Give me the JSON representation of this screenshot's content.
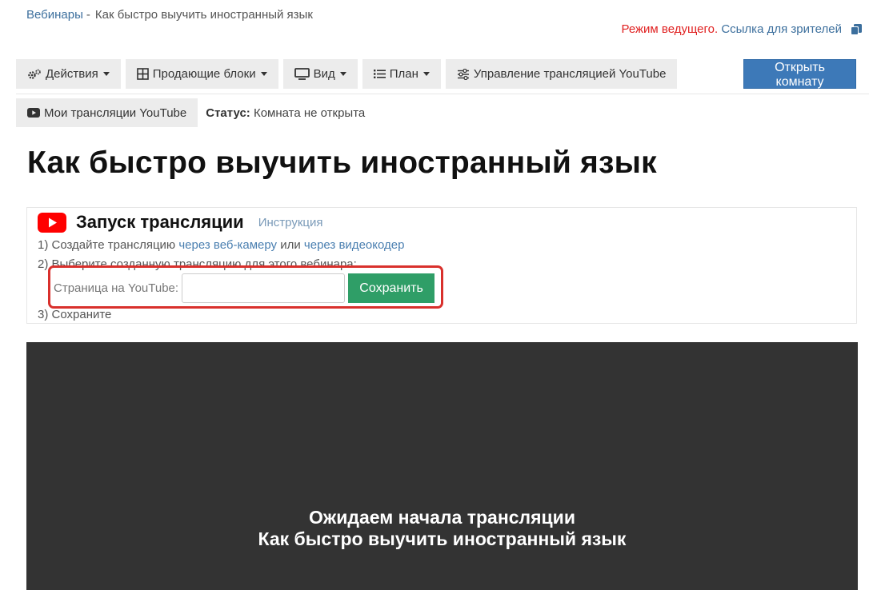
{
  "breadcrumb": {
    "parent": "Вебинары",
    "separator": "-",
    "current": "Как быстро выучить иностранный язык"
  },
  "header": {
    "host_mode": "Режим ведущего.",
    "viewer_link": "Ссылка для зрителей",
    "copy_icon": "copy-icon"
  },
  "toolbar": {
    "actions": "Действия",
    "sales_blocks": "Продающие блоки",
    "view": "Вид",
    "plan": "План",
    "youtube_control": "Управление трансляцией YouTube",
    "open_room": "Открыть комнату"
  },
  "row2": {
    "my_streams": "Мои трансляции YouTube",
    "status_label": "Статус:",
    "status_value": "Комната не открыта"
  },
  "page_title": "Как быстро выучить иностранный язык",
  "panel": {
    "title": "Запуск трансляции",
    "help": "Инструкция",
    "step1_prefix": "1) Создайте трансляцию",
    "step1_link1": "через веб-камеру",
    "step1_mid": "или",
    "step1_link2": "через видеокодер",
    "step2": "2) Выберите созданную трансляцию для этого вебинара:",
    "input_label": "Страница на YouTube:",
    "input_value": "",
    "save": "Сохранить",
    "step3": "3) Сохраните"
  },
  "player": {
    "line1": "Ожидаем начала трансляции",
    "line2": "Как быстро выучить иностранный язык"
  },
  "colors": {
    "accent": "#3d79b8",
    "save": "#2f9e67",
    "highlight": "#d9302c",
    "youtube": "#ff0000",
    "player_bg": "#333333"
  }
}
